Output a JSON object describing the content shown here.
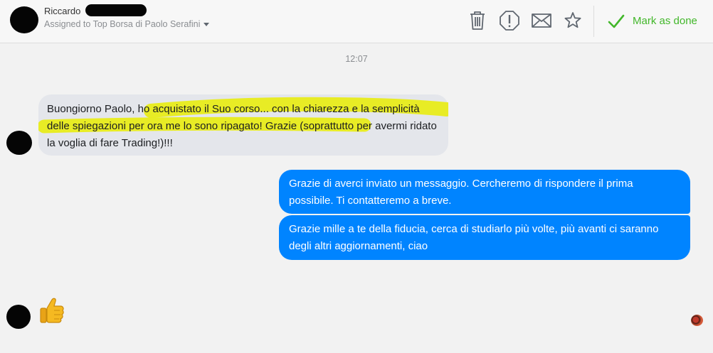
{
  "header": {
    "contact_name": "Riccardo",
    "assigned_text": "Assigned to Top Borsa di Paolo Serafini",
    "actions": [
      {
        "name": "trash-icon",
        "label": "Delete"
      },
      {
        "name": "alert-icon",
        "label": "Spam"
      },
      {
        "name": "mail-icon",
        "label": "Mark unread"
      },
      {
        "name": "star-icon",
        "label": "Follow up"
      }
    ],
    "mark_done_label": "Mark as done"
  },
  "conversation": {
    "timestamp": "12:07",
    "incoming_message": {
      "text_plain_start": "Buongiorno Paolo",
      "text_highlighted": ", ho acquistato il Suo corso... con la chiarezza e la semplicità delle spiegazioni per ora me lo sono ripagato",
      "text_plain_end": "! Grazie (soprattutto per avermi ridato la voglia di fare Trading!)!!!",
      "highlight_color": "#e8ec1a"
    },
    "outgoing_messages": [
      {
        "text": "Grazie di averci inviato un messaggio. Cercheremo di rispondere il prima possibile. Ti contatteremo a breve."
      },
      {
        "text": "Grazie mille a te della fiducia, cerca di studiarlo più volte, più avanti ci saranno degli altri aggiornamenti, ciao"
      }
    ],
    "reaction_emoji": "thumbs-up"
  },
  "colors": {
    "accent_done": "#42b72a",
    "outgoing_bubble": "#0084ff",
    "incoming_bubble": "#e4e6eb"
  }
}
